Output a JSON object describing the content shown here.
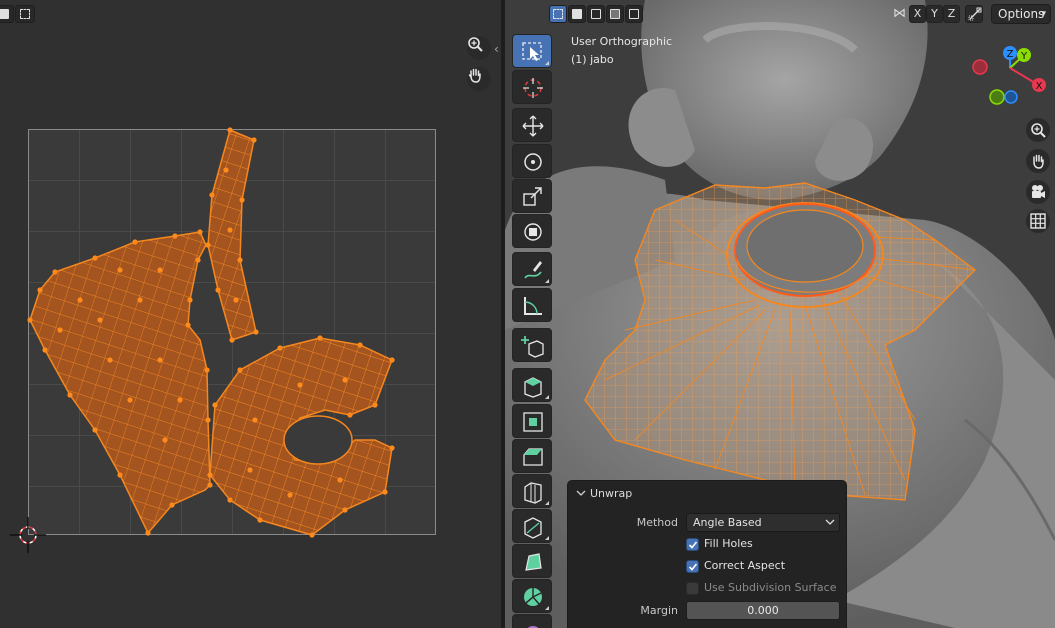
{
  "uv_editor": {
    "header_left_icons": [
      "select-mode-icon",
      "select-box-icon"
    ]
  },
  "viewport": {
    "view_name": "User Orthographic",
    "object_label": "(1) jabo",
    "header_select_modes": [
      "select-box-icon",
      "select-extend-icon",
      "select-subtract-icon",
      "select-invert-icon",
      "select-intersect-icon"
    ],
    "axis_buttons": [
      "X",
      "Y",
      "Z"
    ],
    "options_label": "Options",
    "gizmo": {
      "x": "X",
      "y": "Y",
      "z": "Z",
      "x_color": "#e8384f",
      "y_color": "#8bdc00",
      "z_color": "#2c8fff"
    },
    "toolbar_tools": [
      "select-box-icon",
      "cursor-icon",
      "move-icon",
      "rotate-icon",
      "scale-icon",
      "transform-icon",
      "annotate-icon",
      "measure-icon",
      "add-cube-icon",
      "extrude-region-icon",
      "inset-faces-icon",
      "bevel-icon",
      "loop-cut-icon",
      "knife-icon",
      "poly-build-icon",
      "spin-icon",
      "smooth-icon"
    ]
  },
  "unwrap_panel": {
    "title": "Unwrap",
    "method_label": "Method",
    "method_value": "Angle Based",
    "fill_holes": {
      "label": "Fill Holes",
      "checked": true
    },
    "correct_aspect": {
      "label": "Correct Aspect",
      "checked": true
    },
    "use_subdivision": {
      "label": "Use Subdivision Surface",
      "checked": false
    },
    "margin_label": "Margin",
    "margin_value": "0.000"
  },
  "colors": {
    "accent": "#4772b3",
    "mesh_orange": "#f5871f",
    "uv_fill": "#a4541f"
  }
}
